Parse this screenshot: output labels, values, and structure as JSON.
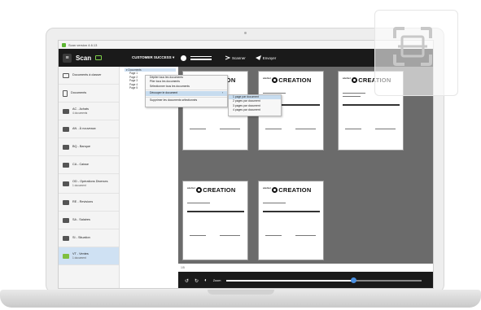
{
  "window": {
    "title": "Scan version 4.6.13"
  },
  "brand": {
    "name": "Scan",
    "menu_glyph": "≡"
  },
  "toolbar": {
    "client": "CUSTOMER SUCCESS",
    "client_chevron": "▾",
    "scan_label": "Scanner",
    "send_label": "Envoyer"
  },
  "sidebar": {
    "items": [
      {
        "label": "Documents à classer",
        "sub": "",
        "icon": "inbox-icon"
      },
      {
        "label": "Documents",
        "sub": "",
        "icon": "document-icon"
      },
      {
        "label": "AC - Achats",
        "sub": "4 documents",
        "icon": "folder-icon"
      },
      {
        "label": "AN - À nouveaux",
        "sub": "",
        "icon": "folder-icon"
      },
      {
        "label": "BQ - Banque",
        "sub": "",
        "icon": "folder-icon"
      },
      {
        "label": "CA - Caisse",
        "sub": "",
        "icon": "folder-icon"
      },
      {
        "label": "OD - Opérations Diverses",
        "sub": "1 document",
        "icon": "folder-icon"
      },
      {
        "label": "RE - Revisions",
        "sub": "",
        "icon": "folder-icon"
      },
      {
        "label": "SA - Salaires",
        "sub": "",
        "icon": "folder-icon"
      },
      {
        "label": "SI - Situation",
        "sub": "",
        "icon": "folder-icon"
      },
      {
        "label": "VT - Ventes",
        "sub": "1 document",
        "icon": "folder-icon",
        "active": true
      }
    ]
  },
  "tree": {
    "root": "Documents",
    "pages": [
      "Page 1",
      "Page 2",
      "Page 3",
      "Page 4",
      "Page 5"
    ]
  },
  "context_menu": {
    "items": [
      "Déplier tous les documents",
      "Plier tous les documents",
      "Sélectionner tous les documents",
      "Découper le document",
      "Supprimer les documents sélectionnés"
    ],
    "submenu_arrow": "›",
    "submenu": [
      "1 page par document",
      "2 pages par document",
      "3 pages par document",
      "4 pages par document"
    ]
  },
  "document": {
    "logo": "CREATION",
    "logo_prefix": "atelier"
  },
  "statusbar": {
    "text": "1/5"
  },
  "bottombar": {
    "rotate_left": "↺",
    "rotate_right": "↻",
    "contrast": "◐",
    "zoom_label": "Zoom",
    "zoom_level": 0.65
  },
  "colors": {
    "toolbar_bg": "#1a1a1a",
    "accent_green": "#5bb531",
    "selection_blue": "#cfe1f3",
    "canvas_bg": "#6b6b6b",
    "zoom_knob": "#4a90e2"
  }
}
